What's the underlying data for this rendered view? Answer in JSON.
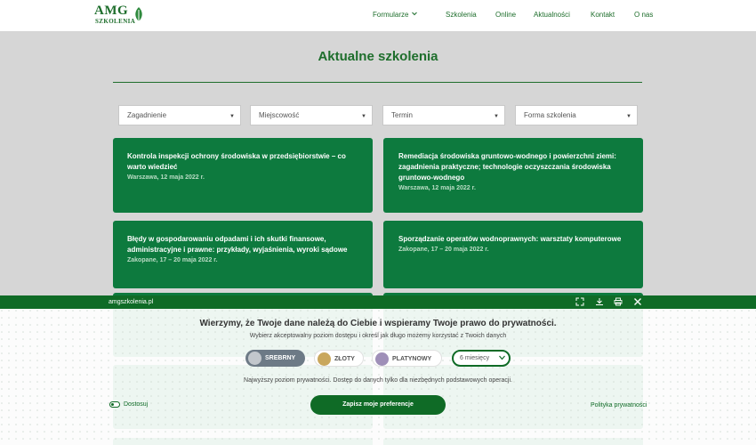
{
  "header": {
    "logo_text": "AMG",
    "logo_subtext": "SZKOLENIA",
    "nav": [
      {
        "label": "Formularze",
        "has_dropdown": true
      },
      {
        "label": "Szkolenia"
      },
      {
        "label": "Online"
      },
      {
        "label": "Aktualności"
      },
      {
        "label": "Kontakt"
      },
      {
        "label": "O nas"
      }
    ]
  },
  "main": {
    "title": "Aktualne szkolenia",
    "filters": [
      "Zagadnienie",
      "Miejscowość",
      "Termin",
      "Forma szkolenia"
    ],
    "cards": [
      {
        "title": "Kontrola inspekcji ochrony środowiska w przedsiębiorstwie – co warto wiedzieć",
        "date": "Warszawa, 12 maja 2022 r."
      },
      {
        "title": "Remediacja środowiska gruntowo-wodnego i powierzchni ziemi: zagadnienia praktyczne; technologie oczyszczania środowiska gruntowo-wodnego",
        "date": "Warszawa, 12 maja 2022 r."
      },
      {
        "title": "Błędy w gospodarowaniu odpadami i ich skutki finansowe, administracyjne i prawne: przykłady, wyjaśnienia, wyroki sądowe",
        "date": "Zakopane, 17 – 20 maja 2022 r."
      },
      {
        "title": "Sporządzanie operatów wodnoprawnych: warsztaty komputerowe",
        "date": "Zakopane, 17 – 20 maja 2022 r."
      }
    ]
  },
  "cookie": {
    "site": "amgszkolenia.pl",
    "heading": "Wierzymy, że Twoje dane należą do Ciebie i wspieramy Twoje prawo do prywatności.",
    "subheading": "Wybierz akceptowalny poziom dostępu i określ jak długo możemy korzystać z Twoich danych",
    "levels": [
      {
        "label": "SREBRNY",
        "color": "#c2c7cc",
        "active": true
      },
      {
        "label": "ZŁOTY",
        "color": "#c9a75d",
        "active": false
      },
      {
        "label": "PLATYNOWY",
        "color": "#9f8fb8",
        "active": false
      }
    ],
    "duration": "6 miesięcy",
    "note": "Najwyższy poziom prywatności. Dostęp do danych tylko dla niezbędnych podstawowych operacji.",
    "customize": "Dostosuj",
    "save": "Zapisz moje preferencje",
    "policy": "Polityka prywatności"
  },
  "colors": {
    "brand_green": "#1e6e2c",
    "card_green": "#0d7a3e",
    "cookie_green": "#0f6b26"
  }
}
